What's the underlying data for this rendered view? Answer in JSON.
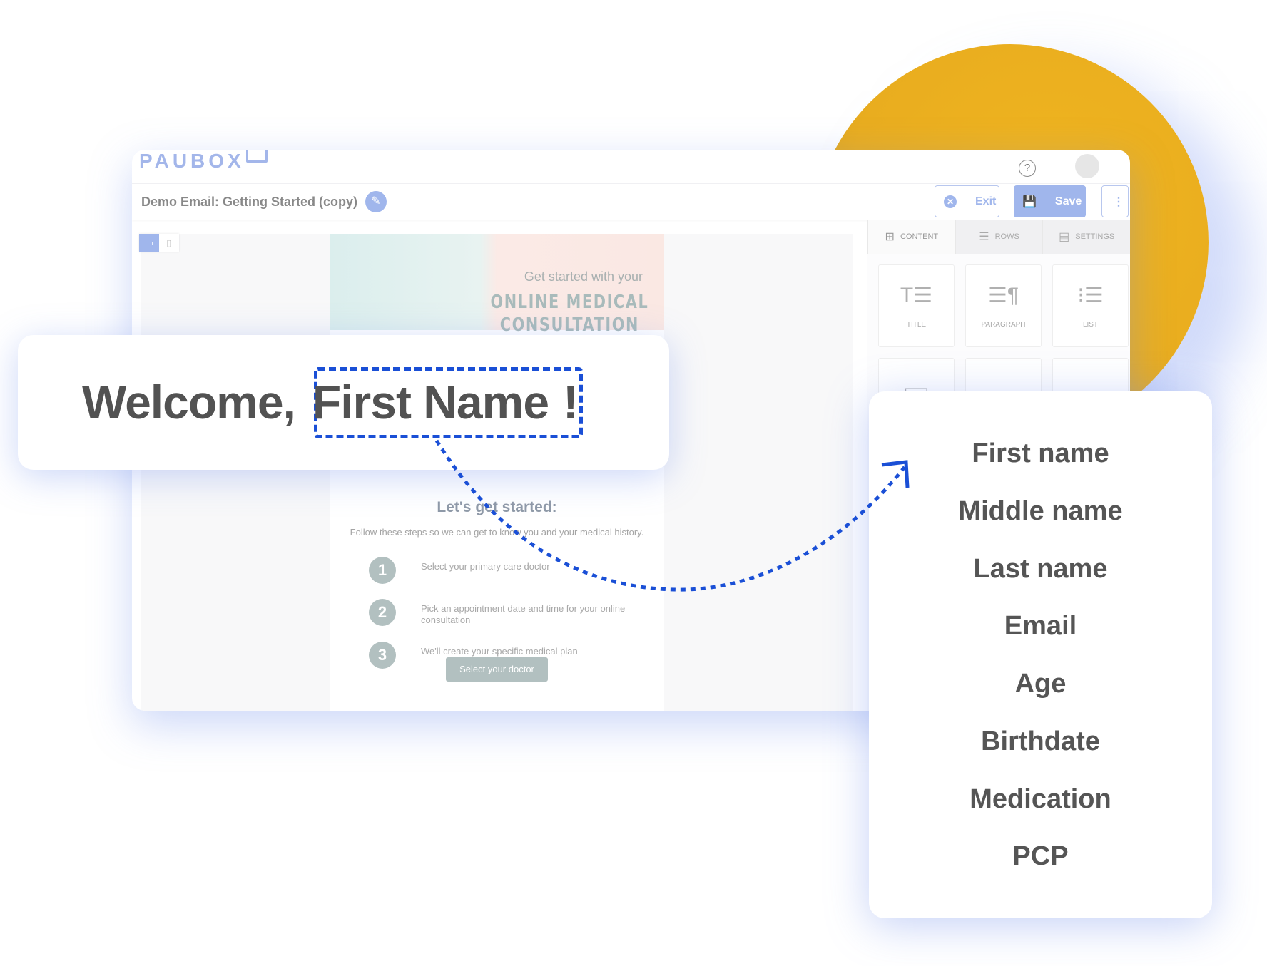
{
  "app": {
    "logo": "PAUBOX",
    "help_icon": "question-circle-icon",
    "avatar_icon": "user-avatar-icon"
  },
  "toolbar": {
    "title": "Demo Email: Getting Started (copy)",
    "exit_label": "Exit",
    "save_label": "Save",
    "more_icon": "vertical-ellipsis-icon"
  },
  "email": {
    "hero_line1": "Get started with your",
    "hero_line2": "ONLINE MEDICAL",
    "hero_line3": "CONSULTATION",
    "heading": "Let's get started:",
    "intro": "Follow these steps so we can get to know you and your medical history.",
    "steps": [
      {
        "num": "1",
        "text": "Select your primary care doctor"
      },
      {
        "num": "2",
        "text": "Pick an appointment date and time for your online consultation"
      },
      {
        "num": "3",
        "text": "We'll create your specific medical plan"
      }
    ],
    "button": "Select your doctor"
  },
  "panel": {
    "tabs": [
      {
        "label": "CONTENT"
      },
      {
        "label": "ROWS"
      },
      {
        "label": "SETTINGS"
      }
    ],
    "tiles": [
      {
        "label": "TITLE"
      },
      {
        "label": "PARAGRAPH"
      },
      {
        "label": "LIST"
      }
    ]
  },
  "welcome": {
    "prefix": "Welcome,",
    "field": "First Name",
    "suffix": "!"
  },
  "merge_fields": [
    "First name",
    "Middle name",
    "Last name",
    "Email",
    "Age",
    "Birthdate",
    "Medication",
    "PCP"
  ],
  "colors": {
    "accent": "#1a4fd6",
    "brand": "#a0b6ec",
    "circle": "#edb11f"
  }
}
